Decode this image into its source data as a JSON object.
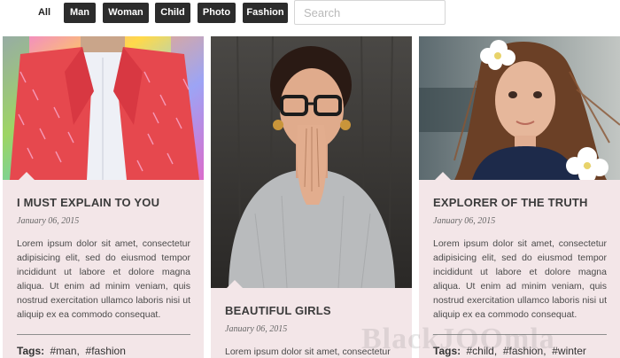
{
  "filters": {
    "items": [
      {
        "label": "All"
      },
      {
        "label": "Man"
      },
      {
        "label": "Woman"
      },
      {
        "label": "Child"
      },
      {
        "label": "Photo"
      },
      {
        "label": "Fashion"
      }
    ],
    "active": "All",
    "search_placeholder": "Search"
  },
  "cards": [
    {
      "image_subject": "man in red patterned jacket",
      "title": "I MUST EXPLAIN TO YOU",
      "date": "January 06, 2015",
      "excerpt": "Lorem ipsum dolor sit amet, consectetur adipisicing elit, sed do eiusmod tempor incididunt ut labore et dolore magna aliqua. Ut enim ad minim veniam, quis nostrud exercitation ullamco laboris nisi ut aliquip ex ea commodo consequat.",
      "tags_label": "Tags:",
      "tags": [
        "#man",
        "#fashion"
      ]
    },
    {
      "image_subject": "woman with glasses, hands at face",
      "title": "BEAUTIFUL GIRLS",
      "date": "January 06, 2015",
      "excerpt": "Lorem ipsum dolor sit amet, consectetur"
    },
    {
      "image_subject": "girl with white flowers in hair",
      "title": "EXPLORER OF THE TRUTH",
      "date": "January 06, 2015",
      "excerpt": "Lorem ipsum dolor sit amet, consectetur adipisicing elit, sed do eiusmod tempor incididunt ut labore et dolore magna aliqua. Ut enim ad minim veniam, quis nostrud exercitation ullamco laboris nisi ut aliquip ex ea commodo consequat.",
      "tags_label": "Tags:",
      "tags": [
        "#child",
        "#fashion",
        "#winter"
      ]
    }
  ],
  "watermark": "BlackJOOmla",
  "colors": {
    "card_bg": "#f3e6e8",
    "filter_bg": "#2c2c2c",
    "filter_text": "#ffffff"
  }
}
